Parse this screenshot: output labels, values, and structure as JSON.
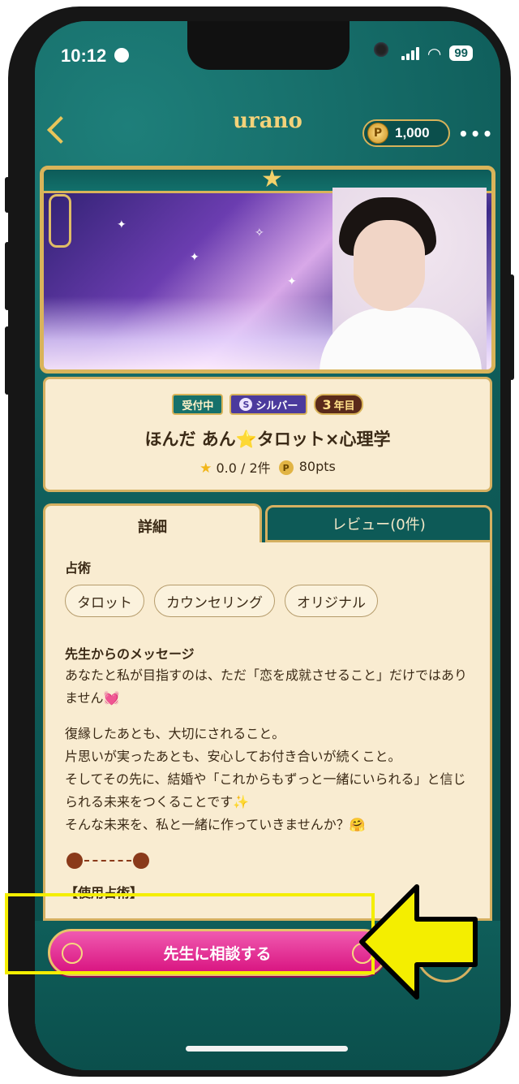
{
  "status_bar": {
    "time": "10:12",
    "battery": "99"
  },
  "header": {
    "title": "urano",
    "points": "1,000",
    "coin_symbol": "P",
    "more": "•••"
  },
  "profile": {
    "badges": {
      "status": "受付中",
      "rank_symbol": "S",
      "rank": "シルバー",
      "years_num": "3",
      "years_label": "年目"
    },
    "name": "ほんだ あん⭐タロット×心理学",
    "rating": "0.0 / 2件",
    "price_symbol": "P",
    "price": "80pts"
  },
  "tabs": [
    {
      "label": "詳細"
    },
    {
      "label": "レビュー(0件)"
    }
  ],
  "details": {
    "divination_title": "占術",
    "divination_tags": [
      "タロット",
      "カウンセリング",
      "オリジナル"
    ],
    "message_title": "先生からのメッセージ",
    "message_paragraphs": [
      "あなたと私が目指すのは、ただ「恋を成就させること」だけではありません💓",
      "復縁したあとも、大切にされること。\n片思いが実ったあとも、安心してお付き合いが続くこと。\nそしてその先に、結婚や「これからもずっと一緒にいられる」と信じられる未来をつくることです✨",
      "そんな未来を、私と一緒に作っていきませんか？🤗"
    ],
    "used_title": "【使用占術】"
  },
  "cta": {
    "label": "先生に相談する"
  },
  "colors": {
    "teal": "#11625f",
    "gold": "#d5b061",
    "cream": "#f9ecd1",
    "pink": "#e0288f",
    "highlight": "#f4ee00"
  }
}
